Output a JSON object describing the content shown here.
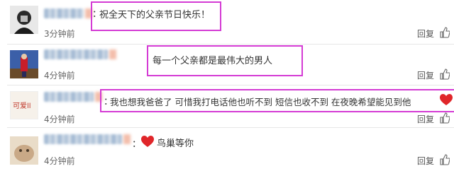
{
  "comments": [
    {
      "text": "祝全天下的父亲节日快乐！",
      "time": "3分钟前",
      "reply": "回复"
    },
    {
      "text": "每一个父亲都是最伟大的男人",
      "time": "4分钟前",
      "reply": "回复"
    },
    {
      "text": "我也想我爸爸了 可惜我打电话他也听不到 短信也收不到 在夜晚希望能见到他",
      "time": "4分钟前",
      "reply": "回复",
      "avatar_text": "可爱ll"
    },
    {
      "text": "鸟巢等你",
      "time": "4分钟前",
      "reply": "回复"
    }
  ],
  "colors": {
    "highlight": "#d43bd4",
    "heart": "#e0262a"
  },
  "icons": [
    "thumbs-up-icon",
    "heart-icon"
  ]
}
